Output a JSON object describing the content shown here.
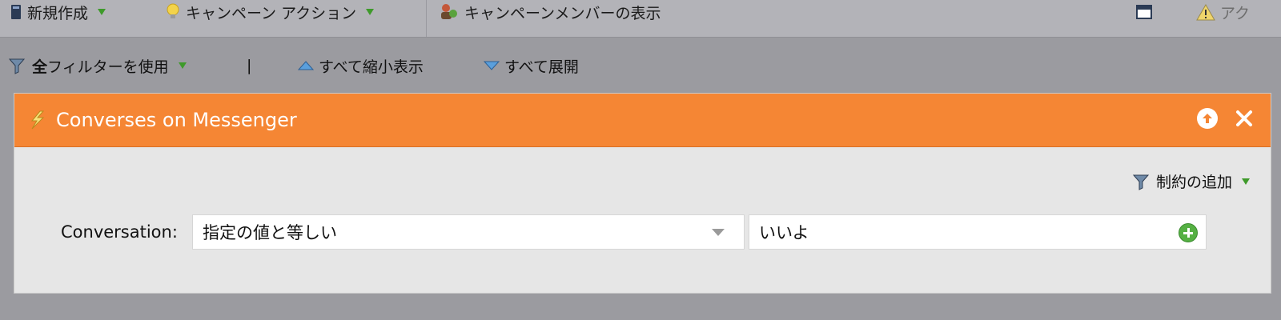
{
  "toolbar": {
    "new_label": "新規作成",
    "campaign_action_label": "キャンペーン アクション",
    "show_members_label": "キャンペーンメンバーの表示",
    "right_label": "アク"
  },
  "filterbar": {
    "use_all_bold": "全",
    "use_all_rest": "フィルターを使用",
    "divider": "|",
    "collapse_all": "すべて縮小表示",
    "expand_all": "すべて展開"
  },
  "panel": {
    "title": "Converses on Messenger",
    "add_constraint": "制約の追加",
    "condition": {
      "label": "Conversation:",
      "operator": "指定の値と等しい",
      "value": "いいよ"
    }
  },
  "colors": {
    "header_orange": "#f58634",
    "toolbar_gray": "#b3b3b8",
    "background": "#9b9ba0"
  }
}
